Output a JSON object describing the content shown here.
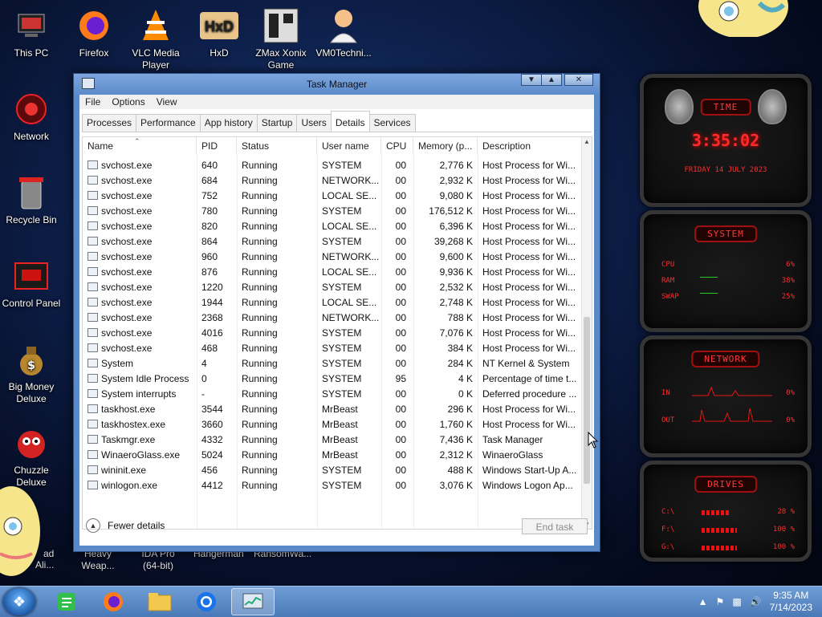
{
  "desktop": {
    "icons": [
      {
        "label": "This PC",
        "icon": "computer-icon"
      },
      {
        "label": "Firefox",
        "icon": "firefox-icon"
      },
      {
        "label": "VLC Media Player",
        "icon": "vlc-icon"
      },
      {
        "label": "HxD",
        "icon": "hxd-icon"
      },
      {
        "label": "ZMax Xonix Game",
        "icon": "game-icon"
      },
      {
        "label": "VM0Techni...",
        "icon": "doctor-icon"
      },
      {
        "label": "Network",
        "icon": "network-icon"
      },
      {
        "label": "Recycle Bin",
        "icon": "recycle-bin-icon"
      },
      {
        "label": "Control Panel",
        "icon": "control-panel-icon"
      },
      {
        "label": "Big Money Deluxe",
        "icon": "money-bag-icon"
      },
      {
        "label": "Chuzzle Deluxe",
        "icon": "chuzzle-icon"
      }
    ],
    "partial_labels": [
      "Heavy Weap...",
      "IDA Pro (64-bit)",
      "Hangerman",
      "RansomWa...",
      "ad",
      "Ali..."
    ]
  },
  "window": {
    "title": "Task Manager",
    "menu": [
      "File",
      "Options",
      "View"
    ],
    "tabs": [
      "Processes",
      "Performance",
      "App history",
      "Startup",
      "Users",
      "Details",
      "Services"
    ],
    "active_tab": "Details",
    "columns": [
      "Name",
      "PID",
      "Status",
      "User name",
      "CPU",
      "Memory (p...",
      "Description"
    ],
    "rows": [
      [
        "svchost.exe",
        "640",
        "Running",
        "SYSTEM",
        "00",
        "2,776 K",
        "Host Process for Wi..."
      ],
      [
        "svchost.exe",
        "684",
        "Running",
        "NETWORK...",
        "00",
        "2,932 K",
        "Host Process for Wi..."
      ],
      [
        "svchost.exe",
        "752",
        "Running",
        "LOCAL SE...",
        "00",
        "9,080 K",
        "Host Process for Wi..."
      ],
      [
        "svchost.exe",
        "780",
        "Running",
        "SYSTEM",
        "00",
        "176,512 K",
        "Host Process for Wi..."
      ],
      [
        "svchost.exe",
        "820",
        "Running",
        "LOCAL SE...",
        "00",
        "6,396 K",
        "Host Process for Wi..."
      ],
      [
        "svchost.exe",
        "864",
        "Running",
        "SYSTEM",
        "00",
        "39,268 K",
        "Host Process for Wi..."
      ],
      [
        "svchost.exe",
        "960",
        "Running",
        "NETWORK...",
        "00",
        "9,600 K",
        "Host Process for Wi..."
      ],
      [
        "svchost.exe",
        "876",
        "Running",
        "LOCAL SE...",
        "00",
        "9,936 K",
        "Host Process for Wi..."
      ],
      [
        "svchost.exe",
        "1220",
        "Running",
        "SYSTEM",
        "00",
        "2,532 K",
        "Host Process for Wi..."
      ],
      [
        "svchost.exe",
        "1944",
        "Running",
        "LOCAL SE...",
        "00",
        "2,748 K",
        "Host Process for Wi..."
      ],
      [
        "svchost.exe",
        "2368",
        "Running",
        "NETWORK...",
        "00",
        "788 K",
        "Host Process for Wi..."
      ],
      [
        "svchost.exe",
        "4016",
        "Running",
        "SYSTEM",
        "00",
        "7,076 K",
        "Host Process for Wi..."
      ],
      [
        "svchost.exe",
        "468",
        "Running",
        "SYSTEM",
        "00",
        "384 K",
        "Host Process for Wi..."
      ],
      [
        "System",
        "4",
        "Running",
        "SYSTEM",
        "00",
        "284 K",
        "NT Kernel & System"
      ],
      [
        "System Idle Process",
        "0",
        "Running",
        "SYSTEM",
        "95",
        "4 K",
        "Percentage of time t..."
      ],
      [
        "System interrupts",
        "-",
        "Running",
        "SYSTEM",
        "00",
        "0 K",
        "Deferred procedure ..."
      ],
      [
        "taskhost.exe",
        "3544",
        "Running",
        "MrBeast",
        "00",
        "296 K",
        "Host Process for Wi..."
      ],
      [
        "taskhostex.exe",
        "3660",
        "Running",
        "MrBeast",
        "00",
        "1,760 K",
        "Host Process for Wi..."
      ],
      [
        "Taskmgr.exe",
        "4332",
        "Running",
        "MrBeast",
        "00",
        "7,436 K",
        "Task Manager"
      ],
      [
        "WinaeroGlass.exe",
        "5024",
        "Running",
        "MrBeast",
        "00",
        "2,312 K",
        "WinaeroGlass"
      ],
      [
        "wininit.exe",
        "456",
        "Running",
        "SYSTEM",
        "00",
        "488 K",
        "Windows Start-Up A..."
      ],
      [
        "winlogon.exe",
        "4412",
        "Running",
        "SYSTEM",
        "00",
        "3,076 K",
        "Windows Logon Ap..."
      ]
    ],
    "fewer_details": "Fewer details",
    "end_task": "End task"
  },
  "gadgets": {
    "time": {
      "title": "TIME",
      "clock": "3:35:02",
      "date": "FRIDAY 14 JULY 2023"
    },
    "system": {
      "title": "SYSTEM",
      "rows": [
        {
          "label": "CPU",
          "value": "6%"
        },
        {
          "label": "RAM",
          "value": "38%"
        },
        {
          "label": "SWAP",
          "value": "25%"
        }
      ]
    },
    "network": {
      "title": "NETWORK",
      "rows": [
        {
          "label": "IN",
          "value": "0%"
        },
        {
          "label": "OUT",
          "value": "0%"
        }
      ]
    },
    "drives": {
      "title": "DRIVES",
      "rows": [
        {
          "label": "C:\\",
          "value": "28 %"
        },
        {
          "label": "F:\\",
          "value": "100 %"
        },
        {
          "label": "G:\\",
          "value": "100 %"
        }
      ]
    }
  },
  "taskbar": {
    "time": "9:35 AM",
    "date": "7/14/2023",
    "items": [
      "notes-icon",
      "firefox-icon",
      "file-explorer-icon",
      "chrome-icon",
      "task-manager-icon"
    ]
  },
  "colors": {
    "accent": "#5a89c7",
    "gadget_red": "#ff2b2b",
    "taskbar": "#5a89c7"
  }
}
